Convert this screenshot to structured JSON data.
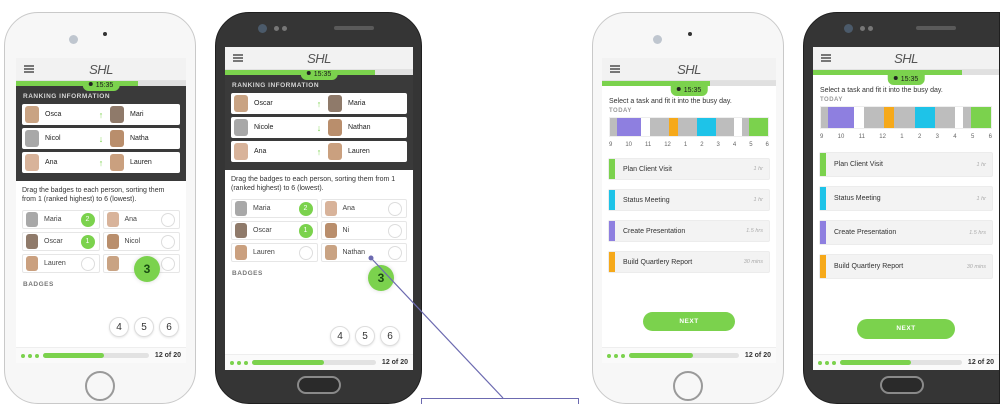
{
  "app": {
    "logo": "SHL",
    "timer": "15:35"
  },
  "ranking": {
    "heading": "RANKING INFORMATION",
    "rows_a": [
      {
        "left": "Osca",
        "dir": "↑",
        "right": "Mari"
      },
      {
        "left": "Nicol",
        "dir": "↓",
        "right": "Natha"
      },
      {
        "left": "Ana",
        "dir": "↑",
        "right": "Lauren"
      }
    ],
    "rows_b": [
      {
        "left": "Oscar",
        "dir": "↑",
        "right": "Maria"
      },
      {
        "left": "Nicole",
        "dir": "↓",
        "right": "Nathan"
      },
      {
        "left": "Ana",
        "dir": "↑",
        "right": "Lauren"
      }
    ],
    "instruction": "Drag the badges to each person, sorting them from 1 (ranked highest) to 6 (lowest).",
    "cells_a": [
      {
        "name": "Maria",
        "num": "2",
        "style": "g"
      },
      {
        "name": "Ana",
        "num": "",
        "style": "e"
      },
      {
        "name": "Oscar",
        "num": "1",
        "style": "g"
      },
      {
        "name": "Nicol",
        "num": "",
        "style": "e"
      },
      {
        "name": "Lauren",
        "num": "",
        "style": "e"
      },
      {
        "name": "",
        "num": "",
        "style": "e"
      }
    ],
    "cells_b": [
      {
        "name": "Maria",
        "num": "2",
        "style": "g"
      },
      {
        "name": "Ana",
        "num": "",
        "style": "e"
      },
      {
        "name": "Oscar",
        "num": "1",
        "style": "g"
      },
      {
        "name": "Ni",
        "num": "",
        "style": "e"
      },
      {
        "name": "Lauren",
        "num": "",
        "style": "e"
      },
      {
        "name": "Nathan",
        "num": "",
        "style": "e"
      }
    ],
    "dragging_badge": "3",
    "badges_label": "BADGES",
    "pool": [
      "4",
      "5",
      "6"
    ]
  },
  "schedule": {
    "intro": "Select a task and fit it into the busy day.",
    "today": "TODAY",
    "hours": [
      "9",
      "10",
      "11",
      "12",
      "1",
      "2",
      "3",
      "4",
      "5",
      "6"
    ],
    "tasks": [
      {
        "name": "Plan Client Visit",
        "duration": "1 hr",
        "color": "#7bd24d"
      },
      {
        "name": "Status Meeting",
        "duration": "1 hr",
        "color": "#1ec3e8"
      },
      {
        "name": "Create Presentation",
        "duration": "1.5 hrs",
        "color": "#8e7fe0"
      },
      {
        "name": "Build Quartlery Report",
        "duration": "30 mins",
        "color": "#f6a91a"
      }
    ],
    "next": "NEXT"
  },
  "progress": {
    "label": "12 of 20",
    "fraction": 0.58
  },
  "colors": {
    "accent": "#7bd24d",
    "dark": "#3a3a3a"
  }
}
